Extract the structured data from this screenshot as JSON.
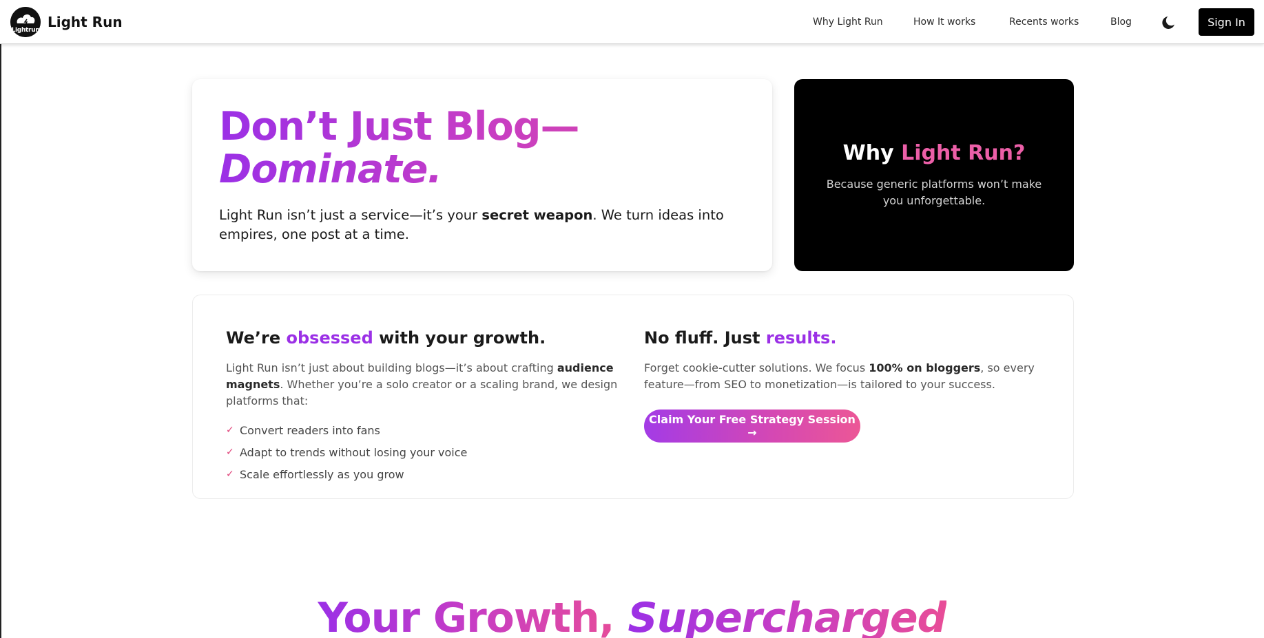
{
  "nav": {
    "logo_text": "Lightrun",
    "brand": "Light Run",
    "links": [
      "Why Light Run",
      "How It works",
      "Recents works",
      "Blog"
    ],
    "theme_icon": "moon-icon",
    "signin_label": "Sign In"
  },
  "hero": {
    "title_line1": "Don’t Just Blog—",
    "title_line2": "Dominate.",
    "desc_pre": "Light Run isn’t just a service—it’s your ",
    "desc_bold": "secret weapon",
    "desc_post": ". We turn ideas into empires, one post at a time."
  },
  "why": {
    "title_pre": "Why ",
    "title_accent": "Light Run?",
    "subtitle": "Because generic platforms won’t make you unforgettable."
  },
  "features": {
    "left": {
      "title_pre": "We’re ",
      "title_accent": "obsessed",
      "title_post": " with your growth.",
      "text_pre": "Light Run isn’t just about building blogs—it’s about crafting ",
      "text_bold": "audience magnets",
      "text_post": ". Whether you’re a solo creator or a scaling brand, we design platforms that:",
      "checklist": [
        "Convert readers into fans",
        "Adapt to trends without losing your voice",
        "Scale effortlessly as you grow"
      ],
      "check_icon": "check-icon"
    },
    "right": {
      "title_pre": "No fluff. Just ",
      "title_accent": "results.",
      "text_pre": "Forget cookie-cutter solutions. We focus ",
      "text_bold": "100% on bloggers",
      "text_post": ", so every feature—from SEO to monetization—is tailored to your success.",
      "cta_label": "Claim Your Free Strategy Session →"
    }
  },
  "growth": {
    "title_pre": "Your Growth, ",
    "title_italic": "Supercharged"
  },
  "colors": {
    "purple": "#9b30e6",
    "pink": "#ec5fa8",
    "black": "#000000"
  }
}
